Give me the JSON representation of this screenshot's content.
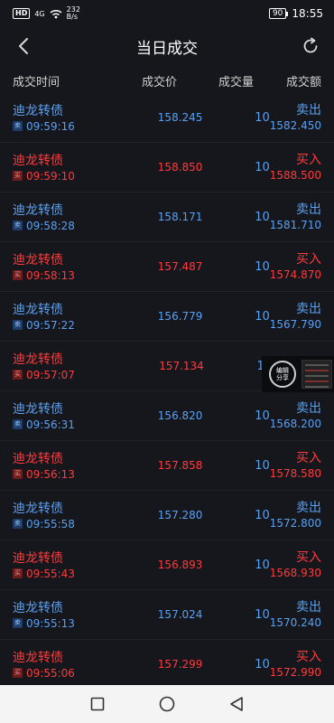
{
  "status": {
    "hd": "HD",
    "signal": "4G",
    "speed_value": "232",
    "speed_unit": "B/s",
    "battery": "90",
    "time": "18:55"
  },
  "header": {
    "title": "当日成交"
  },
  "columns": {
    "time": "成交时间",
    "price": "成交价",
    "volume": "成交量",
    "amount": "成交额"
  },
  "rows": [
    {
      "name": "迪龙转债",
      "tag": "卖",
      "time": "09:59:16",
      "price": "158.245",
      "volume": "10",
      "side": "卖出",
      "amount": "1582.450",
      "type": "sell"
    },
    {
      "name": "迪龙转债",
      "tag": "买",
      "time": "09:59:10",
      "price": "158.850",
      "volume": "10",
      "side": "买入",
      "amount": "1588.500",
      "type": "buy"
    },
    {
      "name": "迪龙转债",
      "tag": "卖",
      "time": "09:58:28",
      "price": "158.171",
      "volume": "10",
      "side": "卖出",
      "amount": "1581.710",
      "type": "sell"
    },
    {
      "name": "迪龙转债",
      "tag": "买",
      "time": "09:58:13",
      "price": "157.487",
      "volume": "10",
      "side": "买入",
      "amount": "1574.870",
      "type": "buy"
    },
    {
      "name": "迪龙转债",
      "tag": "卖",
      "time": "09:57:22",
      "price": "156.779",
      "volume": "10",
      "side": "卖出",
      "amount": "1567.790",
      "type": "sell"
    },
    {
      "name": "迪龙转债",
      "tag": "买",
      "time": "09:57:07",
      "price": "157.134",
      "volume": "10",
      "side": "买入",
      "amount": "",
      "type": "buy"
    },
    {
      "name": "迪龙转债",
      "tag": "卖",
      "time": "09:56:31",
      "price": "156.820",
      "volume": "10",
      "side": "卖出",
      "amount": "1568.200",
      "type": "sell"
    },
    {
      "name": "迪龙转债",
      "tag": "买",
      "time": "09:56:13",
      "price": "157.858",
      "volume": "10",
      "side": "买入",
      "amount": "1578.580",
      "type": "buy"
    },
    {
      "name": "迪龙转债",
      "tag": "卖",
      "time": "09:55:58",
      "price": "157.280",
      "volume": "10",
      "side": "卖出",
      "amount": "1572.800",
      "type": "sell"
    },
    {
      "name": "迪龙转债",
      "tag": "买",
      "time": "09:55:43",
      "price": "156.893",
      "volume": "10",
      "side": "买入",
      "amount": "1568.930",
      "type": "buy"
    },
    {
      "name": "迪龙转债",
      "tag": "卖",
      "time": "09:55:13",
      "price": "157.024",
      "volume": "10",
      "side": "卖出",
      "amount": "1570.240",
      "type": "sell"
    },
    {
      "name": "迪龙转债",
      "tag": "买",
      "time": "09:55:06",
      "price": "157.299",
      "volume": "10",
      "side": "买入",
      "amount": "1572.990",
      "type": "buy"
    }
  ],
  "float_share": {
    "line1": "编辑",
    "line2": "分享"
  },
  "colors": {
    "background": "#15171d",
    "sell": "#5aa0f0",
    "buy": "#ff3b3b"
  },
  "icons": {
    "back": "chevron-left-icon",
    "refresh": "refresh-icon",
    "nav_back": "triangle-back-icon",
    "nav_home": "circle-home-icon",
    "nav_recent": "square-recent-icon"
  }
}
